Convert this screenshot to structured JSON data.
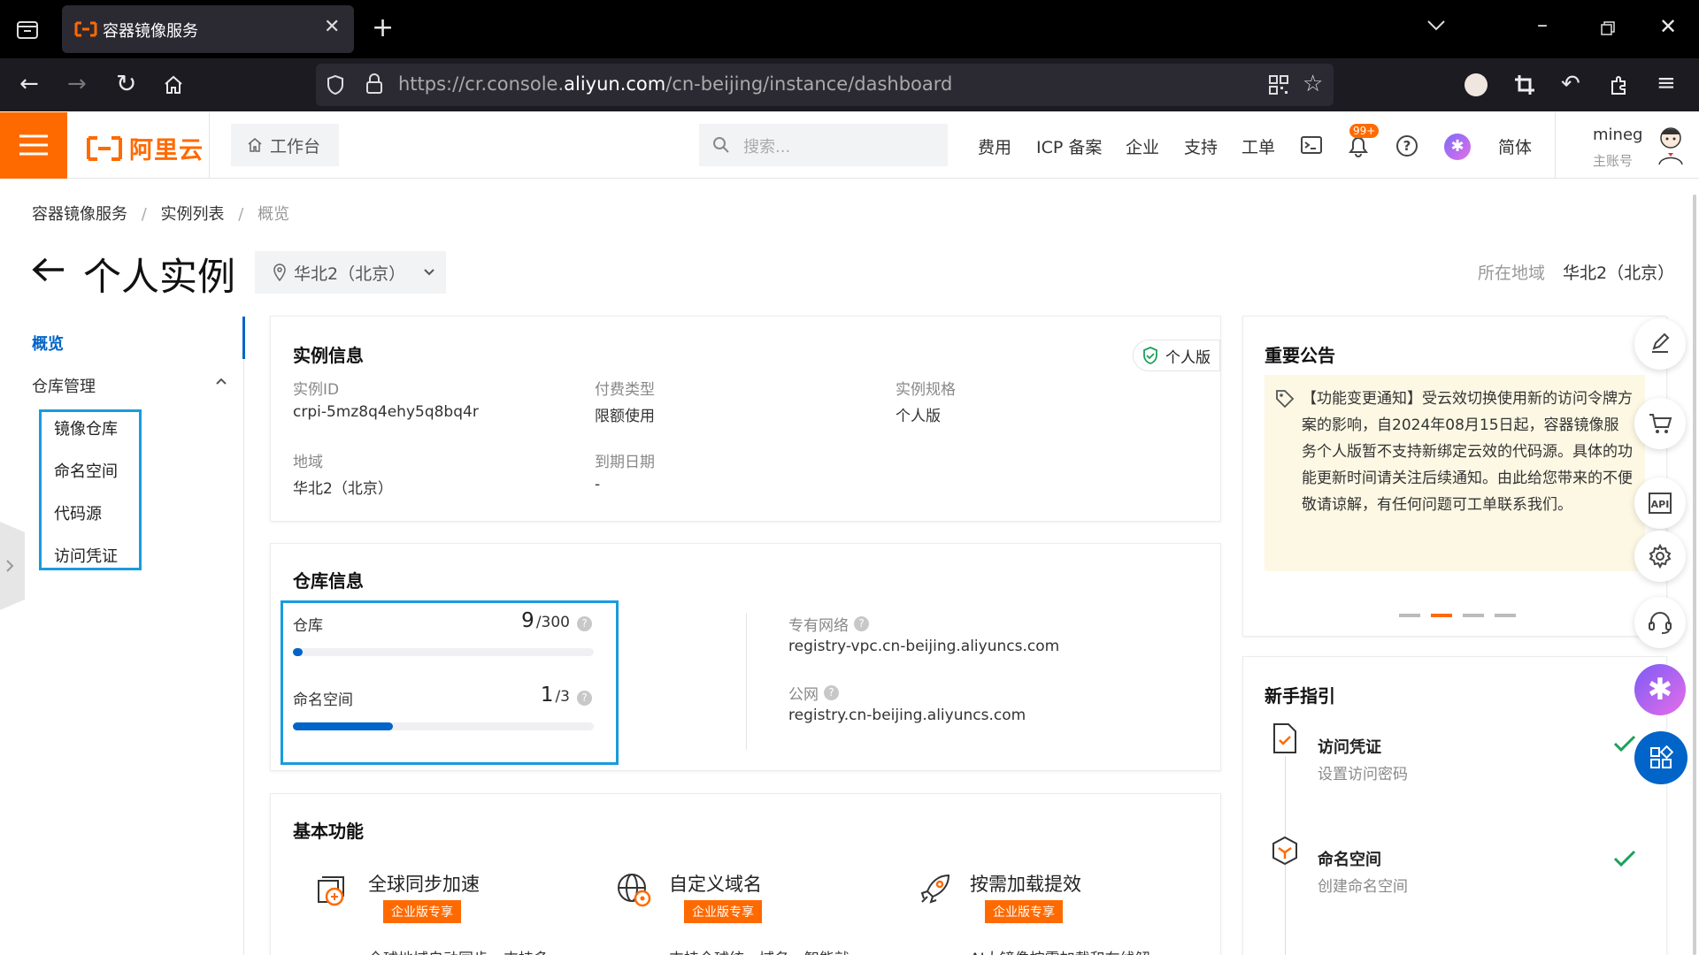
{
  "browser": {
    "tab_title": "容器镜像服务",
    "url_prefix": "https://cr.console.",
    "url_domain": "aliyun.com",
    "url_suffix": "/cn-beijing/instance/dashboard"
  },
  "header": {
    "logo_text": "阿里云",
    "workbench": "工作台",
    "search_placeholder": "搜索...",
    "links": [
      "费用",
      "ICP 备案",
      "企业",
      "支持",
      "工单"
    ],
    "notification_badge": "99+",
    "language": "简体",
    "user_name": "mineg",
    "user_role": "主账号"
  },
  "breadcrumb": [
    "容器镜像服务",
    "实例列表",
    "概览"
  ],
  "breadcrumb_sep": "/",
  "page": {
    "title": "个人实例",
    "region_selector": "华北2（北京）",
    "region_label": "所在地域",
    "region_value": "华北2（北京）"
  },
  "sidebar": {
    "overview": "概览",
    "repo_management": "仓库管理",
    "items": [
      "镜像仓库",
      "命名空间",
      "代码源",
      "访问凭证"
    ]
  },
  "instance_info": {
    "title": "实例信息",
    "edition_badge": "个人版",
    "fields": [
      {
        "label": "实例ID",
        "value": "crpi-5mz8q4ehy5q8bq4r"
      },
      {
        "label": "付费类型",
        "value": "限额使用"
      },
      {
        "label": "实例规格",
        "value": "个人版"
      },
      {
        "label": "地域",
        "value": "华北2（北京）"
      },
      {
        "label": "到期日期",
        "value": "-"
      }
    ]
  },
  "repo_info": {
    "title": "仓库信息",
    "repo_label": "仓库",
    "repo_used": "9",
    "repo_total": "/300",
    "repo_fraction": 0.03,
    "ns_label": "命名空间",
    "ns_used": "1",
    "ns_total": "/3",
    "ns_fraction": 0.333,
    "vpc_label": "专有网络",
    "vpc_value": "registry-vpc.cn-beijing.aliyuncs.com",
    "public_label": "公网",
    "public_value": "registry.cn-beijing.aliyuncs.com"
  },
  "basic_features": {
    "title": "基本功能",
    "items": [
      {
        "name": "全球同步加速",
        "tag": "企业版专享",
        "desc": "全球地域自动同步，支持多"
      },
      {
        "name": "自定义域名",
        "tag": "企业版专享",
        "desc": "支持全球统一域名，智能就"
      },
      {
        "name": "按需加载提效",
        "tag": "企业版专享",
        "desc": "AI大镜像按需加载和在线解"
      }
    ]
  },
  "announcement": {
    "title": "重要公告",
    "text": "【功能变更通知】受云效切换使用新的访问令牌方案的影响，自2024年08月15日起，容器镜像服务个人版暂不支持新绑定云效的代码源。具体的功能更新时间请关注后续通知。由此给您带来的不便敬请谅解，有任何问题可工单联系我们。",
    "active_dot": 1
  },
  "guide": {
    "title": "新手指引",
    "steps": [
      {
        "name": "访问凭证",
        "desc": "设置访问密码"
      },
      {
        "name": "命名空间",
        "desc": "创建命名空间"
      }
    ]
  },
  "colors": {
    "brand_orange": "#ff6a00",
    "primary_blue": "#0064c8",
    "success_green": "#1aa15a"
  }
}
